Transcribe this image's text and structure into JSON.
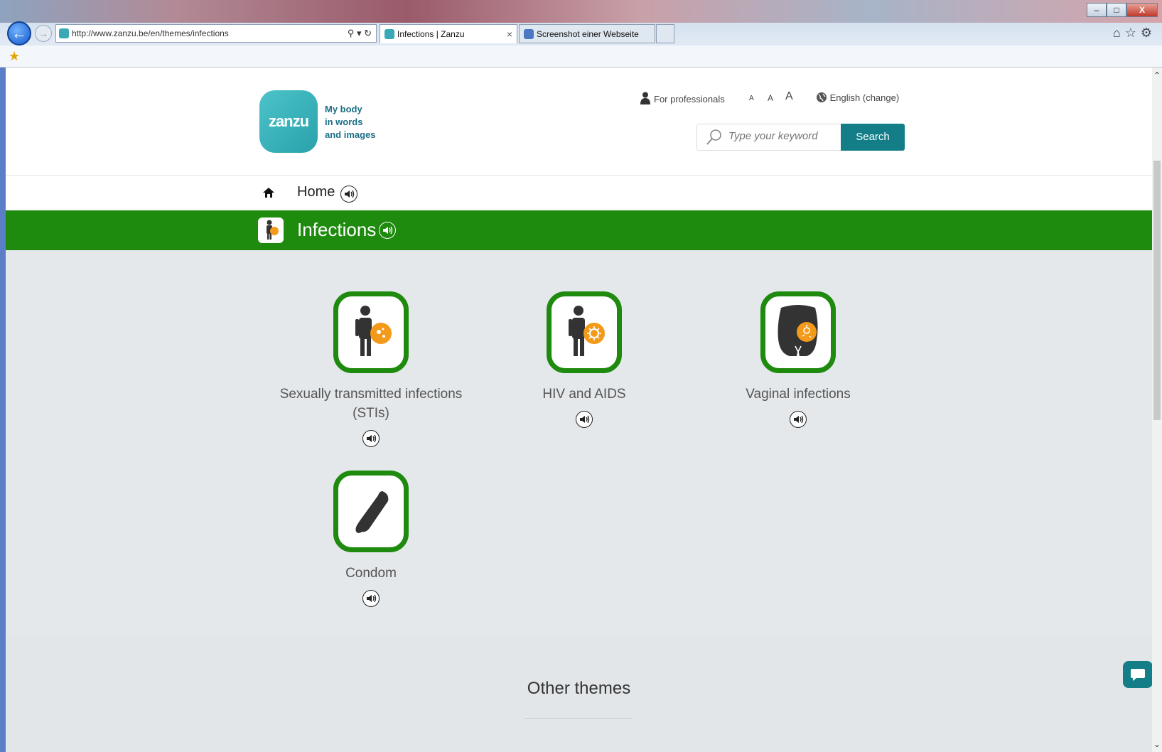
{
  "browser": {
    "url": "http://www.zanzu.be/en/themes/infections",
    "tabs": [
      {
        "label": "Infections | Zanzu"
      },
      {
        "label": "Screenshot einer Webseite ma..."
      }
    ],
    "window_buttons": [
      "–",
      "□",
      "X"
    ]
  },
  "site": {
    "logo_text": "zanzu",
    "tagline": [
      "My body",
      "in words",
      "and images"
    ],
    "for_professionals": "For professionals",
    "font_sizes": [
      "A",
      "A",
      "A"
    ],
    "language": "English (change)",
    "search": {
      "placeholder": "Type your keyword",
      "button": "Search"
    }
  },
  "nav": {
    "home": "Home"
  },
  "section": {
    "title": "Infections"
  },
  "topics": [
    {
      "line1": "Sexually transmitted infections",
      "line2": "(STIs)"
    },
    {
      "line1": "HIV and AIDS",
      "line2": ""
    },
    {
      "line1": "Vaginal infections",
      "line2": ""
    },
    {
      "line1": "Condom",
      "line2": ""
    }
  ],
  "other_themes": {
    "title": "Other themes"
  },
  "colors": {
    "green": "#1e8a0e",
    "teal": "#137d88",
    "orange": "#f39a1b",
    "grey_bg": "#e4e8eb"
  }
}
